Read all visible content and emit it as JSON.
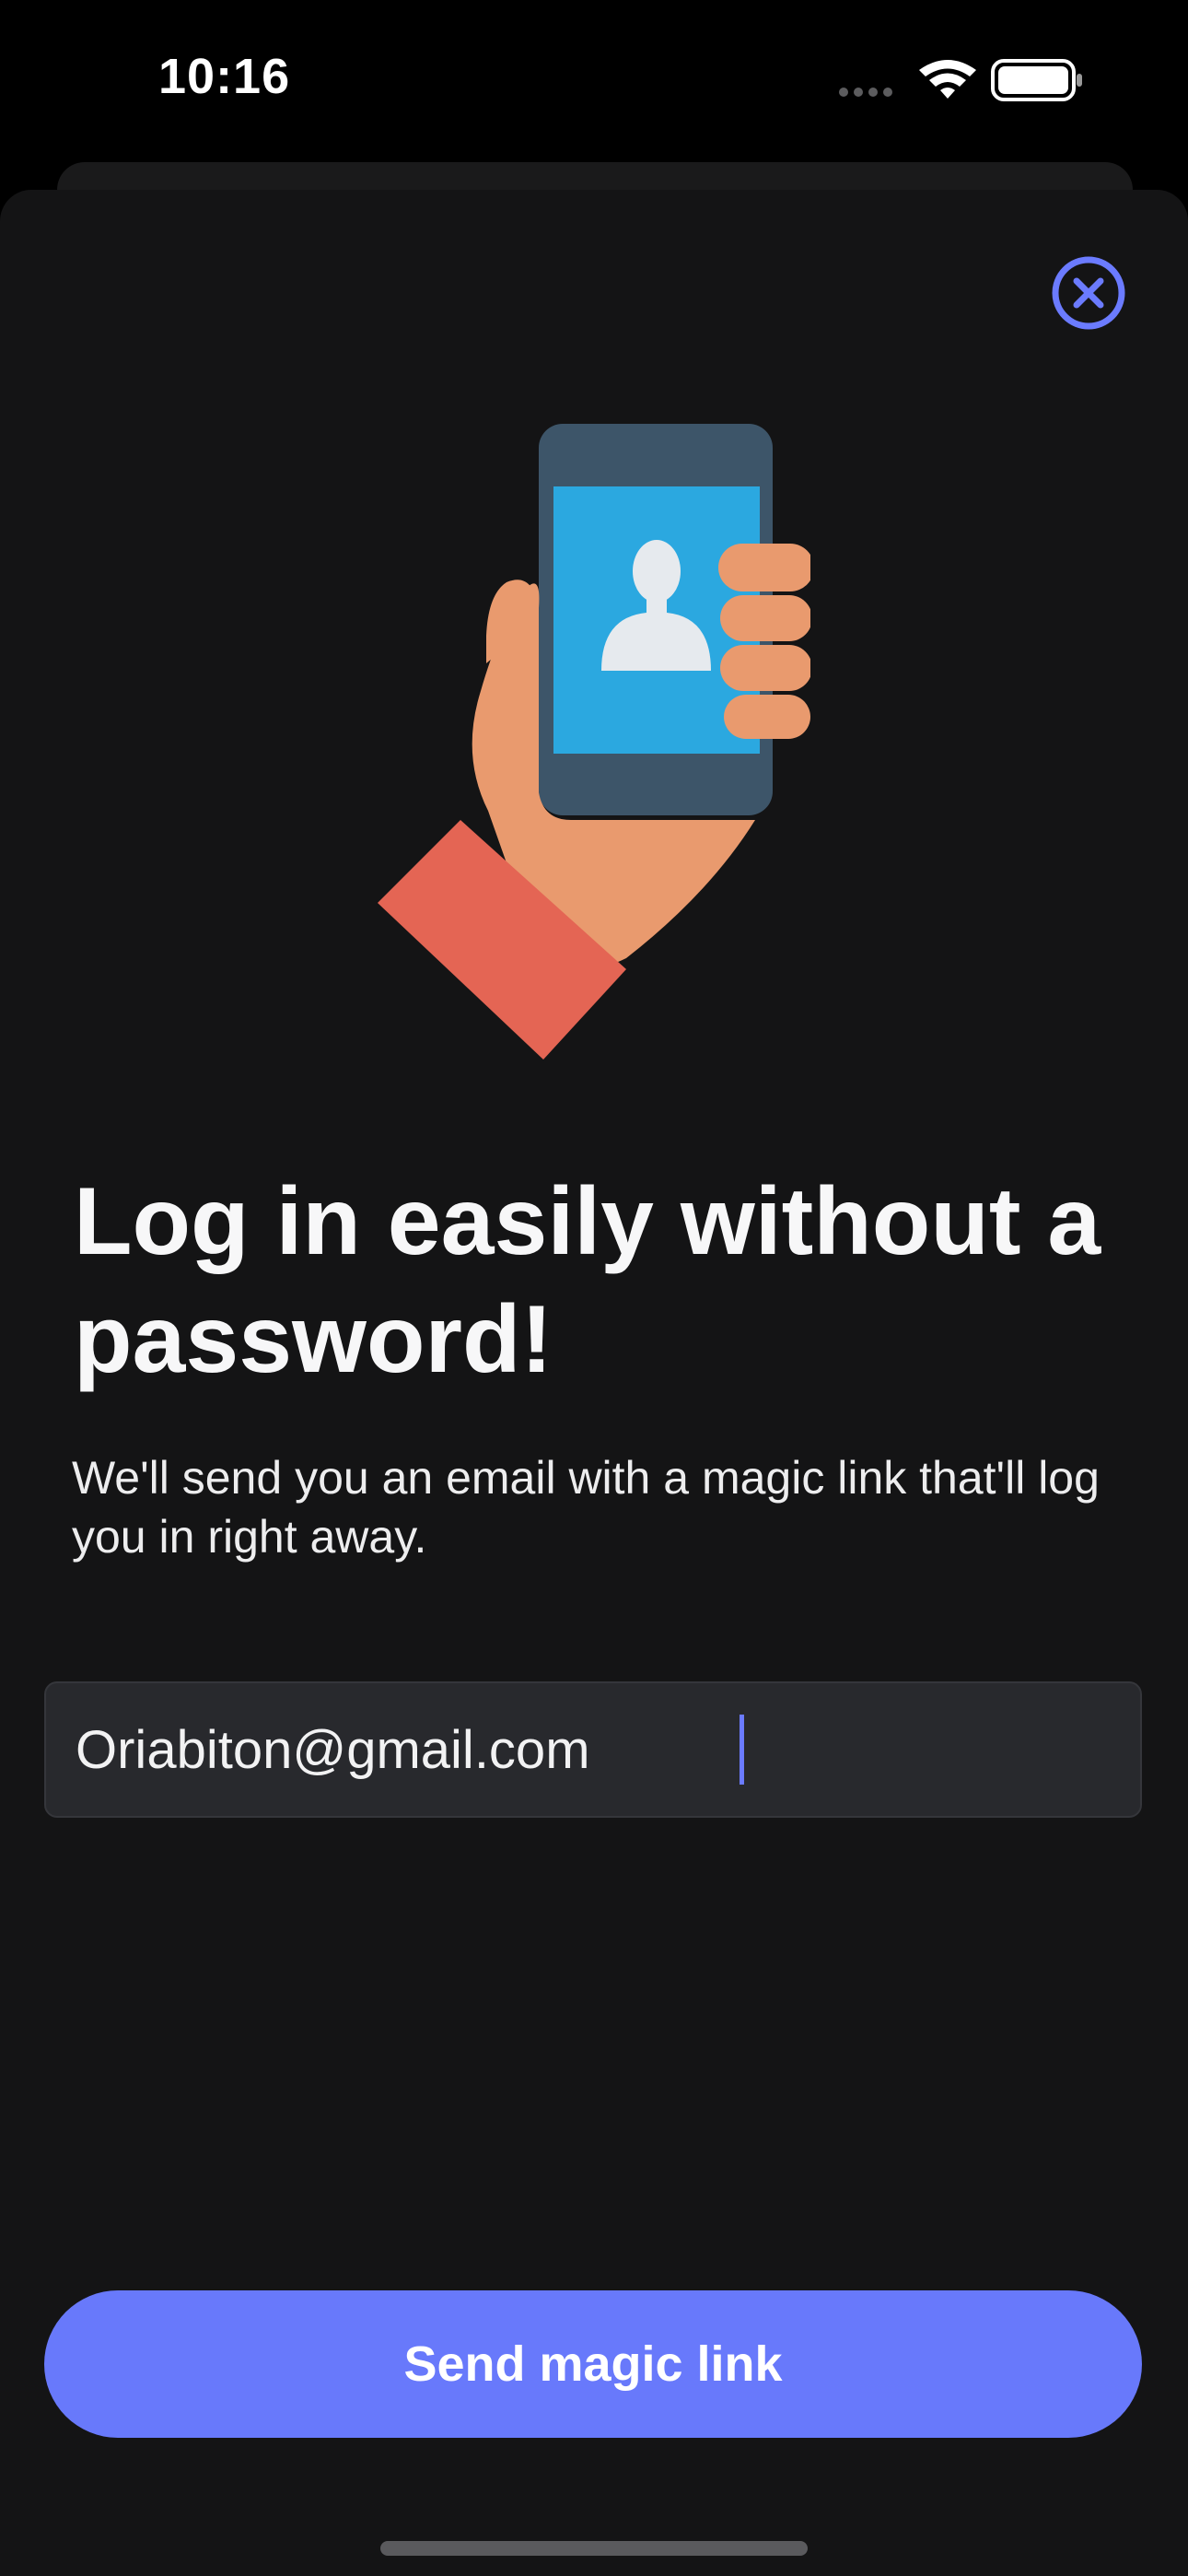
{
  "status_bar": {
    "time": "10:16",
    "signal_icon": "signal-dots-icon",
    "wifi_icon": "wifi-icon",
    "battery_icon": "battery-icon"
  },
  "modal": {
    "close_icon": "close-circle-icon",
    "illustration_icon": "hand-holding-phone-icon",
    "title": "Log in easily without a password!",
    "subtitle": "We'll send you an email with a magic link that'll log you in right away.",
    "email_field": {
      "value": "Oriabiton@gmail.com"
    },
    "send_button_label": "Send magic link"
  },
  "colors": {
    "accent": "#6879fb",
    "background": "#141415",
    "field_background": "#28292d"
  }
}
